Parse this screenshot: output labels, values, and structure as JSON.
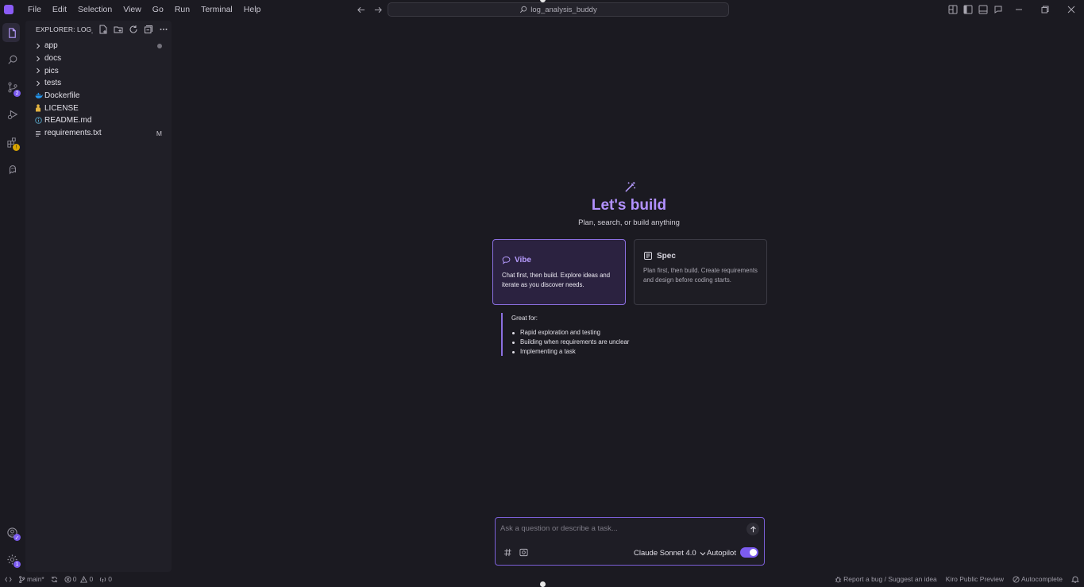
{
  "menu": [
    "File",
    "Edit",
    "Selection",
    "View",
    "Go",
    "Run",
    "Terminal",
    "Help"
  ],
  "command_center": {
    "text": "log_analysis_buddy"
  },
  "explorer": {
    "title": "EXPLORER: LOG_A...",
    "items": [
      {
        "name": "app",
        "type": "folder",
        "decoration": "dot"
      },
      {
        "name": "docs",
        "type": "folder",
        "decoration": ""
      },
      {
        "name": "pics",
        "type": "folder",
        "decoration": ""
      },
      {
        "name": "tests",
        "type": "folder",
        "decoration": ""
      },
      {
        "name": "Dockerfile",
        "type": "docker-file",
        "decoration": ""
      },
      {
        "name": "LICENSE",
        "type": "license-file",
        "decoration": ""
      },
      {
        "name": "README.md",
        "type": "info-file",
        "decoration": ""
      },
      {
        "name": "requirements.txt",
        "type": "text-file",
        "decoration": "M"
      }
    ]
  },
  "activity_badges": {
    "source_control": "2",
    "settings": "1"
  },
  "welcome": {
    "title": "Let's build",
    "subtitle": "Plan, search, or build anything",
    "vibe": {
      "title": "Vibe",
      "description": "Chat first, then build. Explore ideas and iterate as you discover needs."
    },
    "spec": {
      "title": "Spec",
      "description": "Plan first, then build. Create requirements and design before coding starts."
    },
    "great_for": {
      "title": "Great for:",
      "items": [
        "Rapid exploration and testing",
        "Building when requirements are unclear",
        "Implementing a task"
      ]
    }
  },
  "chat": {
    "placeholder": "Ask a question or describe a task...",
    "model": "Claude Sonnet 4.0",
    "autopilot_label": "Autopilot",
    "autopilot_on": true
  },
  "statusbar": {
    "branch": "main*",
    "errors": "0",
    "warnings": "0",
    "ports": "0",
    "report": "Report a bug / Suggest an idea",
    "preview": "Kiro Public Preview",
    "autocomplete": "Autocomplete"
  },
  "colors": {
    "accent": "#8b5cf6",
    "accent_text": "#b291ff",
    "background": "#1b1a21",
    "sidebar": "#201f27"
  }
}
